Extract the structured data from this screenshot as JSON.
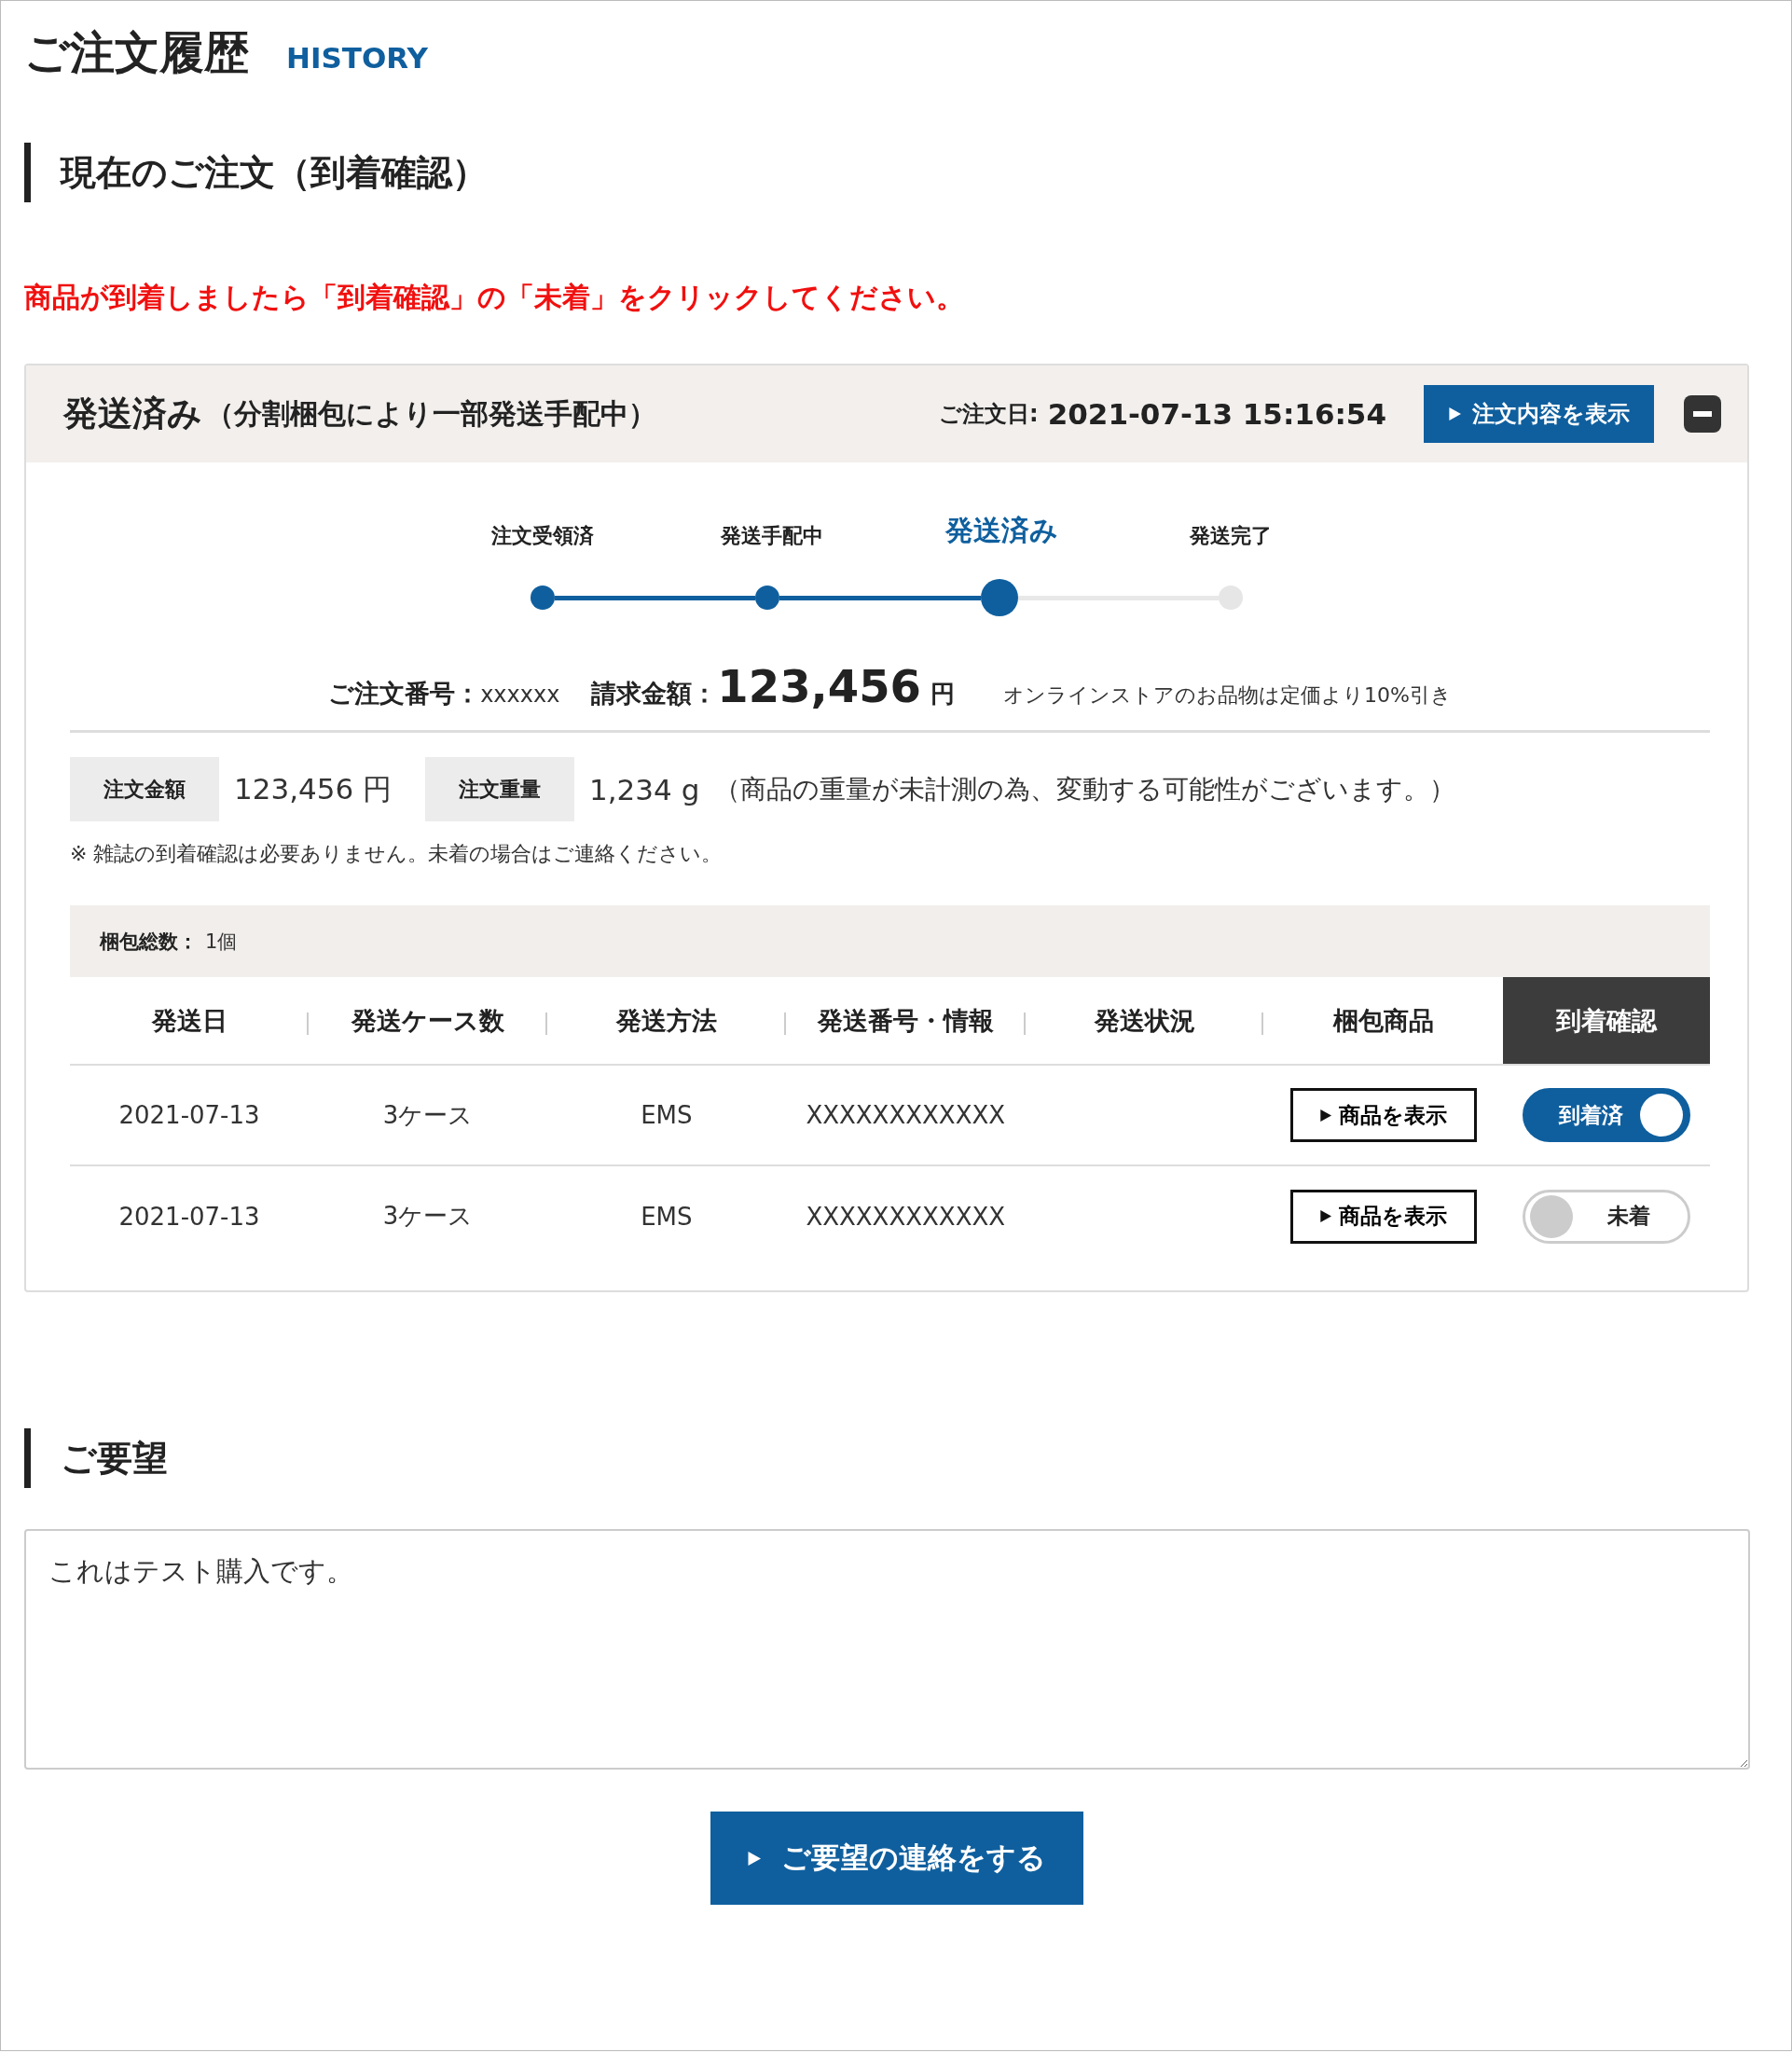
{
  "page": {
    "title": "ご注文履歴",
    "subtitle": "HISTORY"
  },
  "current_section": {
    "heading": "現在のご注文（到着確認）",
    "notice": "商品が到着しましたら「到着確認」の「未着」をクリックしてください。"
  },
  "order": {
    "status": "発送済み",
    "status_note": "（分割梱包により一部発送手配中）",
    "date_label": "ご注文日:",
    "date": "2021-07-13 15:16:54",
    "detail_button": "注文内容を表示",
    "expanded": true,
    "steps": [
      {
        "label": "注文受領済",
        "done": true,
        "selected": false
      },
      {
        "label": "発送手配中",
        "done": true,
        "selected": false
      },
      {
        "label": "発送済み",
        "done": true,
        "selected": true
      },
      {
        "label": "発送完了",
        "done": false,
        "selected": false
      }
    ],
    "order_number_label": "ご注文番号：",
    "order_number": "xxxxxx",
    "amount_label": "請求金額：",
    "amount": "123,456",
    "currency": "円",
    "discount_note": "オンラインストアのお品物は定価より10%引き",
    "summary": [
      {
        "label": "注文金額",
        "value": "123,456 円"
      },
      {
        "label": "注文重量",
        "value": "1,234 g"
      }
    ],
    "weight_note": "（商品の重量が未計測の為、変動する可能性がございます。）",
    "footnote": "※ 雑誌の到着確認は必要ありません。未着の場合はご連絡ください。",
    "package_count_label": "梱包総数：",
    "package_count": "1個",
    "columns": [
      {
        "label": "発送日",
        "highlighted": false
      },
      {
        "label": "発送ケース数",
        "highlighted": false
      },
      {
        "label": "発送方法",
        "highlighted": false
      },
      {
        "label": "発送番号・情報",
        "highlighted": false
      },
      {
        "label": "発送状況",
        "highlighted": false
      },
      {
        "label": "梱包商品",
        "highlighted": false
      },
      {
        "label": "到着確認",
        "highlighted": true
      }
    ],
    "rows": [
      {
        "date": "2021-07-13",
        "cases": "3ケース",
        "method": "EMS",
        "tracking": "XXXXXXXXXXXX",
        "items_button": "商品を表示",
        "arrival": {
          "label": "到着済",
          "on": true
        }
      },
      {
        "date": "2021-07-13",
        "cases": "3ケース",
        "method": "EMS",
        "tracking": "XXXXXXXXXXXX",
        "items_button": "商品を表示",
        "arrival": {
          "label": "未着",
          "on": false
        }
      }
    ]
  },
  "requests": {
    "heading": "ご要望",
    "text": "これはテスト購入です。",
    "button": "ご要望の連絡をする"
  }
}
